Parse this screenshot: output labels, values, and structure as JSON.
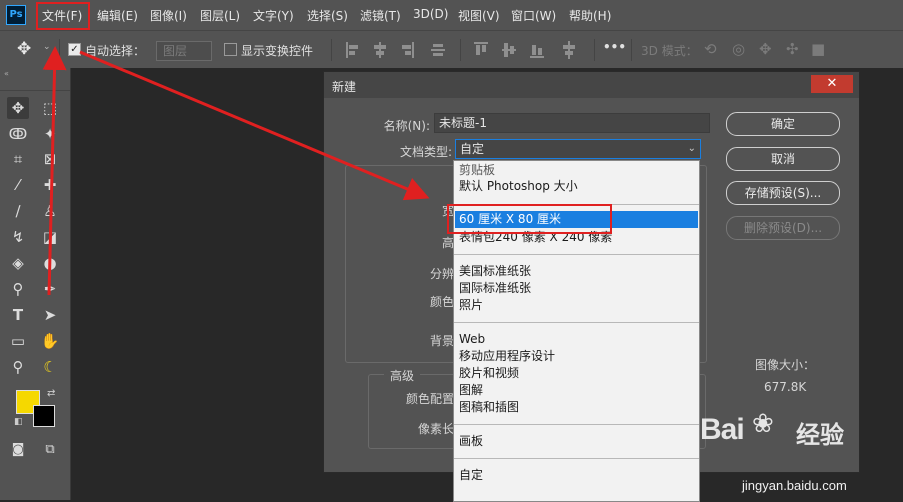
{
  "app": {
    "logo_text": "Ps"
  },
  "menubar": {
    "items": [
      "文件(F)",
      "编辑(E)",
      "图像(I)",
      "图层(L)",
      "文字(Y)",
      "选择(S)",
      "滤镜(T)",
      "3D(D)",
      "视图(V)",
      "窗口(W)",
      "帮助(H)"
    ]
  },
  "options_bar": {
    "auto_select_label": "自动选择：",
    "auto_select_value": "图层",
    "show_transform_label": "显示变换控件",
    "more": "•••",
    "mode_3d_label": "3D 模式："
  },
  "dialog": {
    "title": "新建",
    "name_label": "名称(N):",
    "name_value": "未标题-1",
    "doctype_label": "文档类型:",
    "doctype_value": "自定",
    "partial_labels": {
      "width": "宽",
      "height": "高",
      "resolution": "分辨",
      "color_mode": "颜色",
      "background": "背景"
    },
    "advanced_label": "高级",
    "advanced_partial": {
      "color_profile": "颜色配置",
      "pixel_aspect": "像素长"
    },
    "image_size_label": "图像大小：",
    "image_size_value": "677.8K",
    "buttons": {
      "ok": "确定",
      "cancel": "取消",
      "save_preset": "存储预设(S)...",
      "delete_preset": "删除预设(D)..."
    }
  },
  "dropdown": {
    "groups": [
      [
        "剪贴板",
        "默认 Photoshop 大小"
      ],
      [
        "60 厘米 X 80 厘米",
        "表情包240 像素 X 240 像素"
      ],
      [
        "美国标准纸张",
        "国际标准纸张",
        "照片"
      ],
      [
        "Web",
        "移动应用程序设计",
        "胶片和视频",
        "图解",
        "图稿和插图"
      ],
      [
        "画板"
      ],
      [
        "自定"
      ]
    ],
    "selected": "60 厘米 X 80 厘米"
  },
  "watermark": {
    "brand": "Bai",
    "brand2": "经验",
    "url": "jingyan.baidu.com"
  },
  "colors": {
    "annotation_red": "#e02020",
    "foreground": "#f5d800",
    "background": "#000000",
    "selection_blue": "#1a7fe0"
  }
}
